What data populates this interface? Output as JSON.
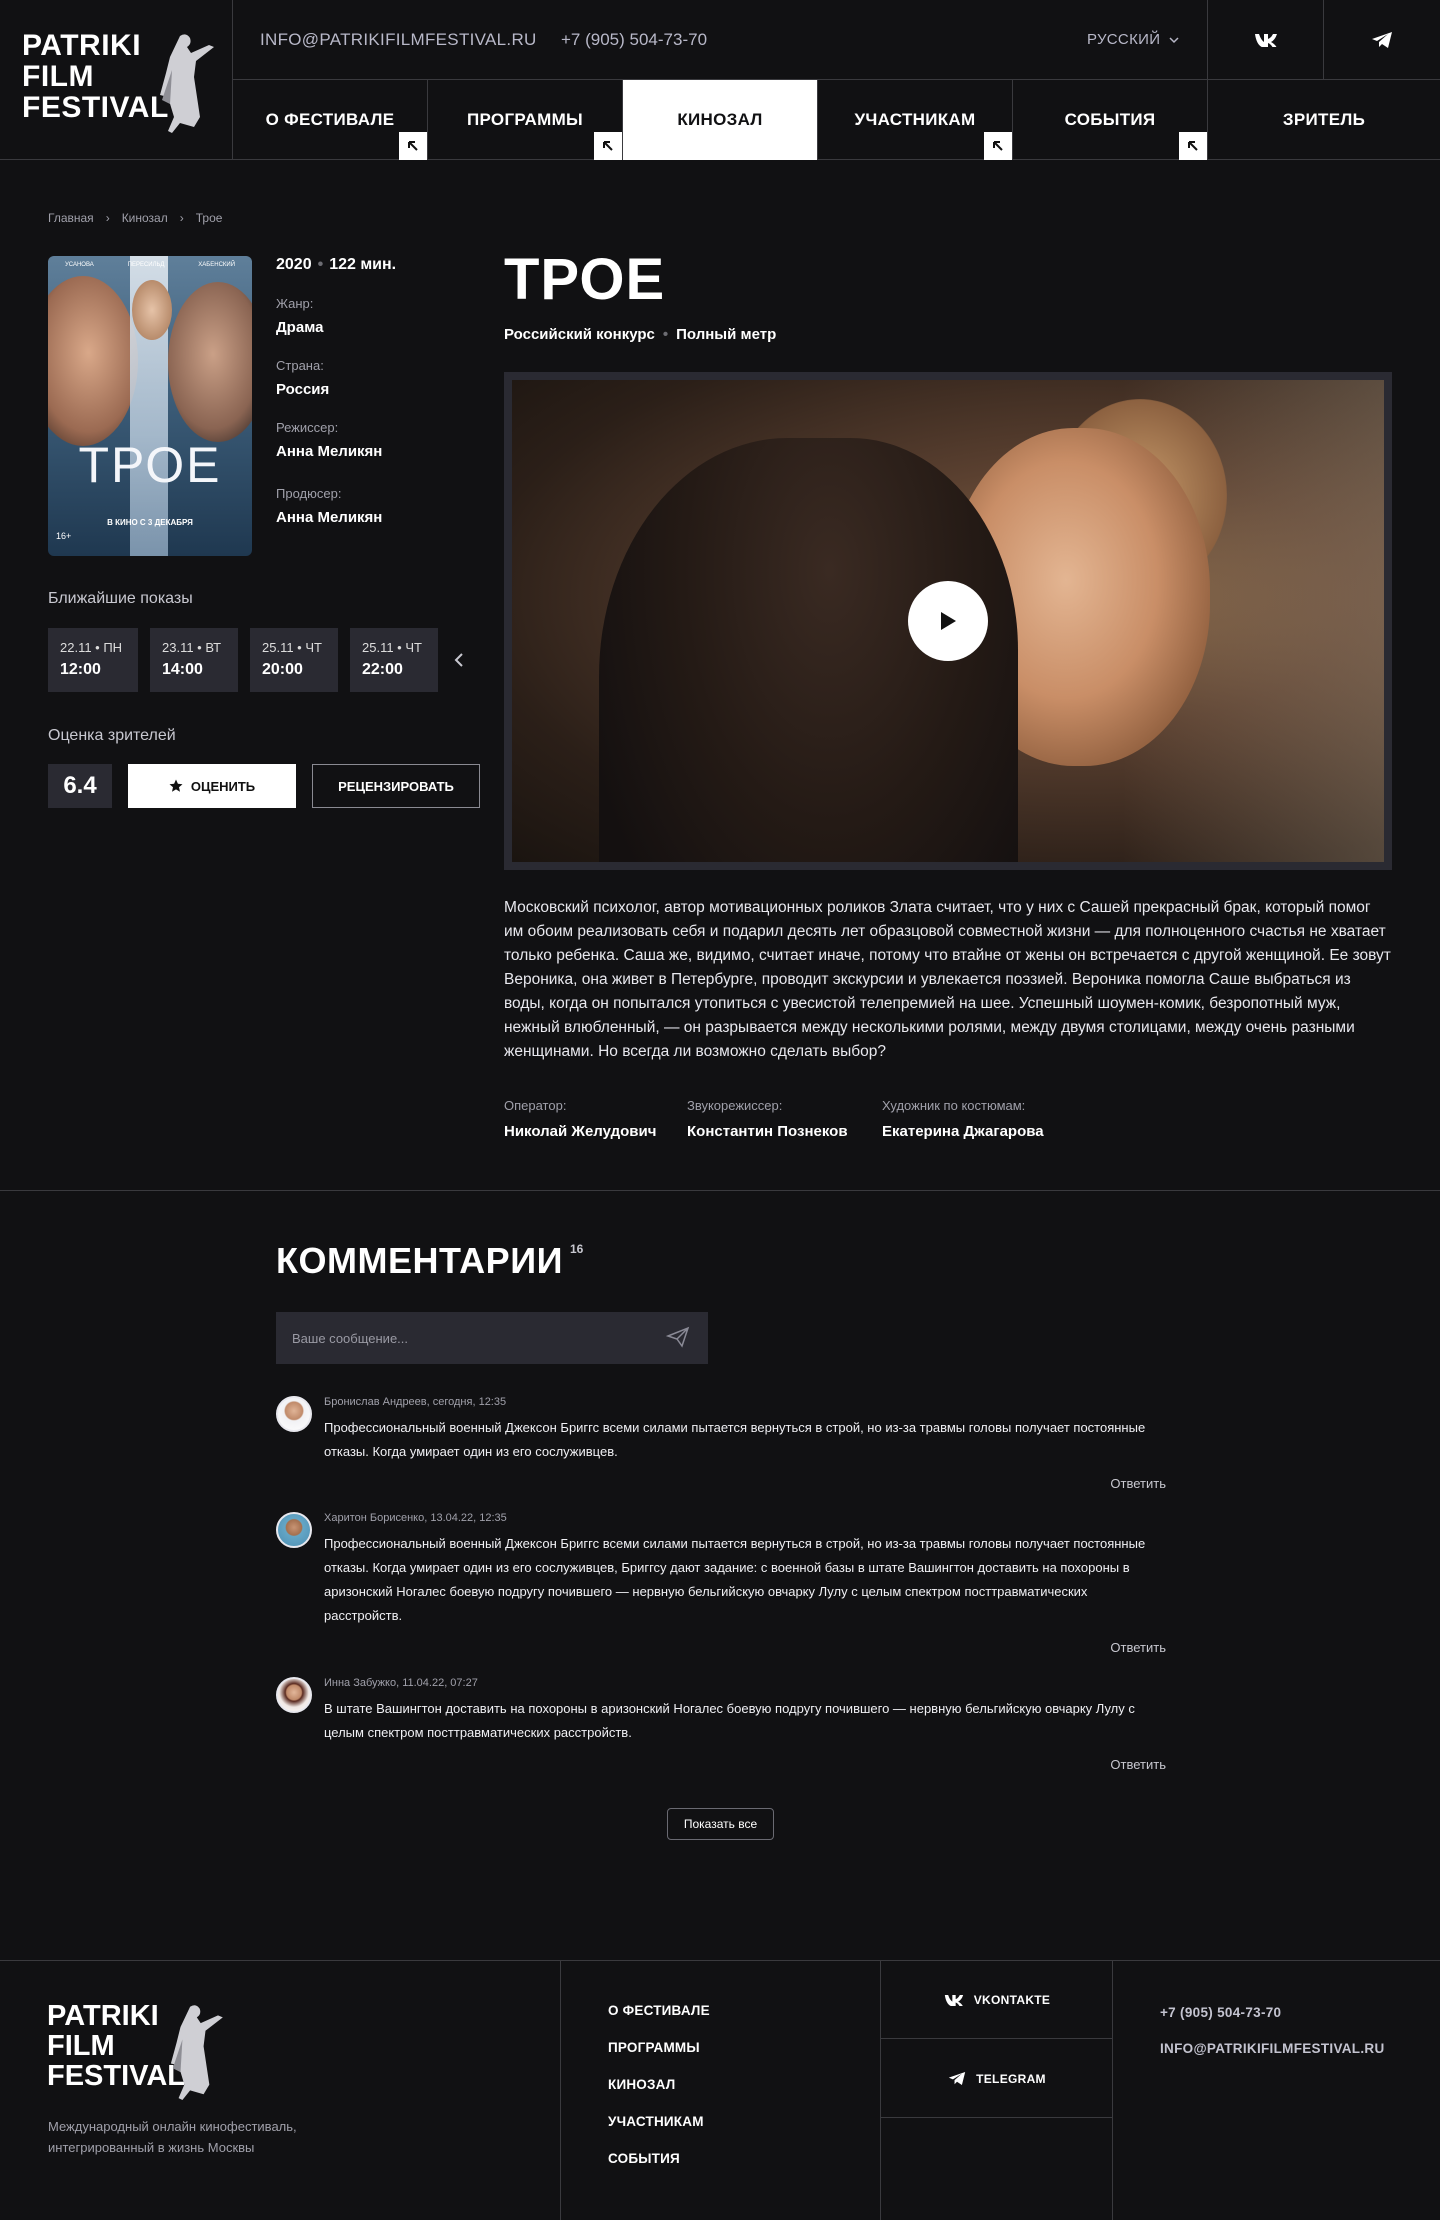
{
  "header": {
    "logo_lines": [
      "PATRIKI",
      "FILM",
      "FESTIVAL"
    ],
    "email": "INFO@PATRIKIFILMFESTIVAL.RU",
    "phone": "+7 (905) 504-73-70",
    "language": "РУССКИЙ",
    "nav": [
      {
        "label": "О ФЕСТИВАЛЕ",
        "arrow": true
      },
      {
        "label": "ПРОГРАММЫ",
        "arrow": true
      },
      {
        "label": "КИНОЗАЛ",
        "active": true
      },
      {
        "label": "УЧАСТНИКАМ",
        "arrow": true
      },
      {
        "label": "СОБЫТИЯ",
        "arrow": true
      },
      {
        "label": "ЗРИТЕЛЬ"
      }
    ]
  },
  "breadcrumb": [
    "Главная",
    "Кинозал",
    "Трое"
  ],
  "poster": {
    "names": [
      "УСАНОВА",
      "ПЕРЕСИЛЬД",
      "ХАБЕНСКИЙ"
    ],
    "title": "ТРОЕ",
    "release": "В КИНО С 3 ДЕКАБРЯ",
    "age": "16+"
  },
  "film": {
    "year": "2020",
    "duration": "122 мин.",
    "genre_label": "Жанр:",
    "genre": "Драма",
    "country_label": "Страна:",
    "country": "Россия",
    "director_label": "Режиссер:",
    "director": "Анна Меликян",
    "producer_label": "Продюсер:",
    "producer": "Анна Меликян",
    "title": "ТРОЕ",
    "competition": "Российский конкурс",
    "format": "Полный метр",
    "description": "Московский психолог, автор мотивационных роликов Злата считает, что у них с Сашей прекрасный брак, который помог им обоим реализовать себя и подарил десять лет образцовой совместной жизни — для полноценного счастья не хватает только ребенка. Саша же, видимо, считает иначе, потому что втайне от жены он встречается с другой женщиной. Ее зовут Вероника, она живет в Петербурге, проводит экскурсии и увлекается поэзией. Вероника помогла Саше выбраться из воды, когда он попытался утопиться с увесистой телепремией на шее. Успешный шоумен-комик, безропотный муж, нежный влюбленный, — он разрывается между несколькими ролями, между двумя столицами, между очень разными женщинами. Но всегда ли возможно сделать выбор?",
    "crew": [
      {
        "label": "Оператор:",
        "name": "Николай Желудович"
      },
      {
        "label": "Звукорежиссер:",
        "name": "Константин Познеков"
      },
      {
        "label": "Художник по костюмам:",
        "name": "Екатерина Джагарова"
      }
    ]
  },
  "screenings": {
    "title": "Ближайшие показы",
    "items": [
      {
        "date": "22.11 • ПН",
        "time": "12:00"
      },
      {
        "date": "23.11 • ВТ",
        "time": "14:00"
      },
      {
        "date": "25.11 • ЧТ",
        "time": "20:00"
      },
      {
        "date": "25.11 • ЧТ",
        "time": "22:00"
      }
    ]
  },
  "rating": {
    "title": "Оценка зрителей",
    "score": "6.4",
    "rate_label": "ОЦЕНИТЬ",
    "review_label": "РЕЦЕНЗИРОВАТЬ"
  },
  "comments": {
    "title": "КОММЕНТАРИИ",
    "count": "16",
    "placeholder": "Ваше сообщение...",
    "reply_label": "Ответить",
    "show_all": "Показать все",
    "items": [
      {
        "author": "Бронислав Андреев, сегодня, 12:35",
        "text": "Профессиональный военный Джексон Бриггс всеми силами пытается вернуться в строй, но из-за травмы головы получает постоянные отказы. Когда умирает один из его сослуживцев."
      },
      {
        "author": "Харитон Борисенко, 13.04.22, 12:35",
        "text": "Профессиональный военный Джексон Бриггс всеми силами пытается вернуться в строй, но из-за травмы головы получает постоянные отказы. Когда умирает один из его сослуживцев, Бриггсу дают задание: с военной базы в штате Вашингтон доставить на похороны в аризонский Ногалес боевую подругу почившего — нервную бельгийскую овчарку Лулу с целым спектром посттравматических расстройств."
      },
      {
        "author": "Инна Забужко, 11.04.22, 07:27",
        "text": "В штате Вашингтон доставить на похороны в аризонский Ногалес боевую подругу почившего — нервную бельгийскую овчарку Лулу с целым спектром посттравматических расстройств."
      }
    ]
  },
  "footer": {
    "about": "Международный онлайн кинофестиваль, интегрированный в жизнь Москвы",
    "menu": [
      "О ФЕСТИВАЛЕ",
      "ПРОГРАММЫ",
      "КИНОЗАЛ",
      "УЧАСТНИКАМ",
      "СОБЫТИЯ"
    ],
    "social": [
      "VKONTAKTE",
      "TELEGRAM"
    ],
    "phone": "+7 (905) 504-73-70",
    "email": "INFO@PATRIKIFILMFESTIVAL.RU"
  },
  "colors": {
    "background": "#111113",
    "panel": "#2a2a32",
    "accent": "#ffffff",
    "muted": "#a0a0aa"
  }
}
